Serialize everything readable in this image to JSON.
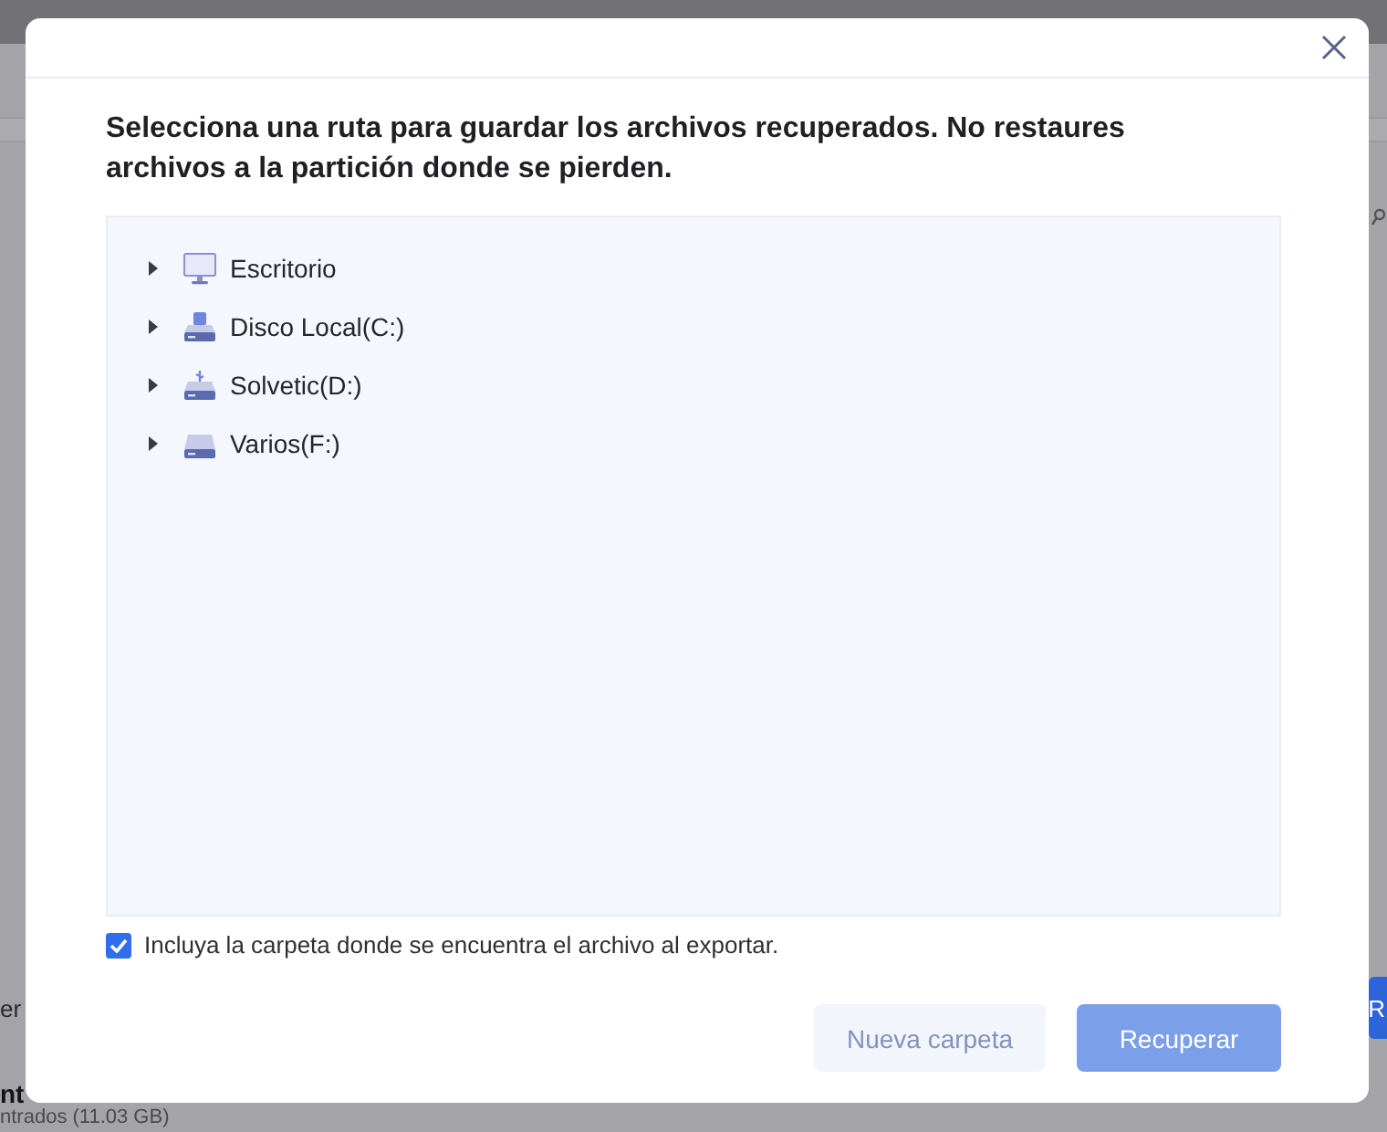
{
  "background_app": {
    "left_fragments": [
      "er",
      "nt"
    ],
    "status_text": "ntrados (11.03 GB)",
    "button_fragment": "R"
  },
  "dialog": {
    "title": "Selecciona una ruta para guardar los archivos recuperados. No restaures archivos a la partición donde se pierden.",
    "tree": {
      "items": [
        {
          "label": "Escritorio",
          "kind": "desktop",
          "expanded": false
        },
        {
          "label": "Disco Local(C:)",
          "kind": "system_drive",
          "expanded": false
        },
        {
          "label": "Solvetic(D:)",
          "kind": "usb_drive",
          "expanded": false
        },
        {
          "label": "Varios(F:)",
          "kind": "drive",
          "expanded": false
        }
      ]
    },
    "include_folder": {
      "label": "Incluya la carpeta donde se encuentra el archivo al exportar.",
      "checked": true
    },
    "buttons": [
      {
        "label": "Nueva carpeta",
        "kind": "secondary",
        "disabled": true
      },
      {
        "label": "Recuperar",
        "kind": "primary",
        "disabled": true
      }
    ]
  }
}
